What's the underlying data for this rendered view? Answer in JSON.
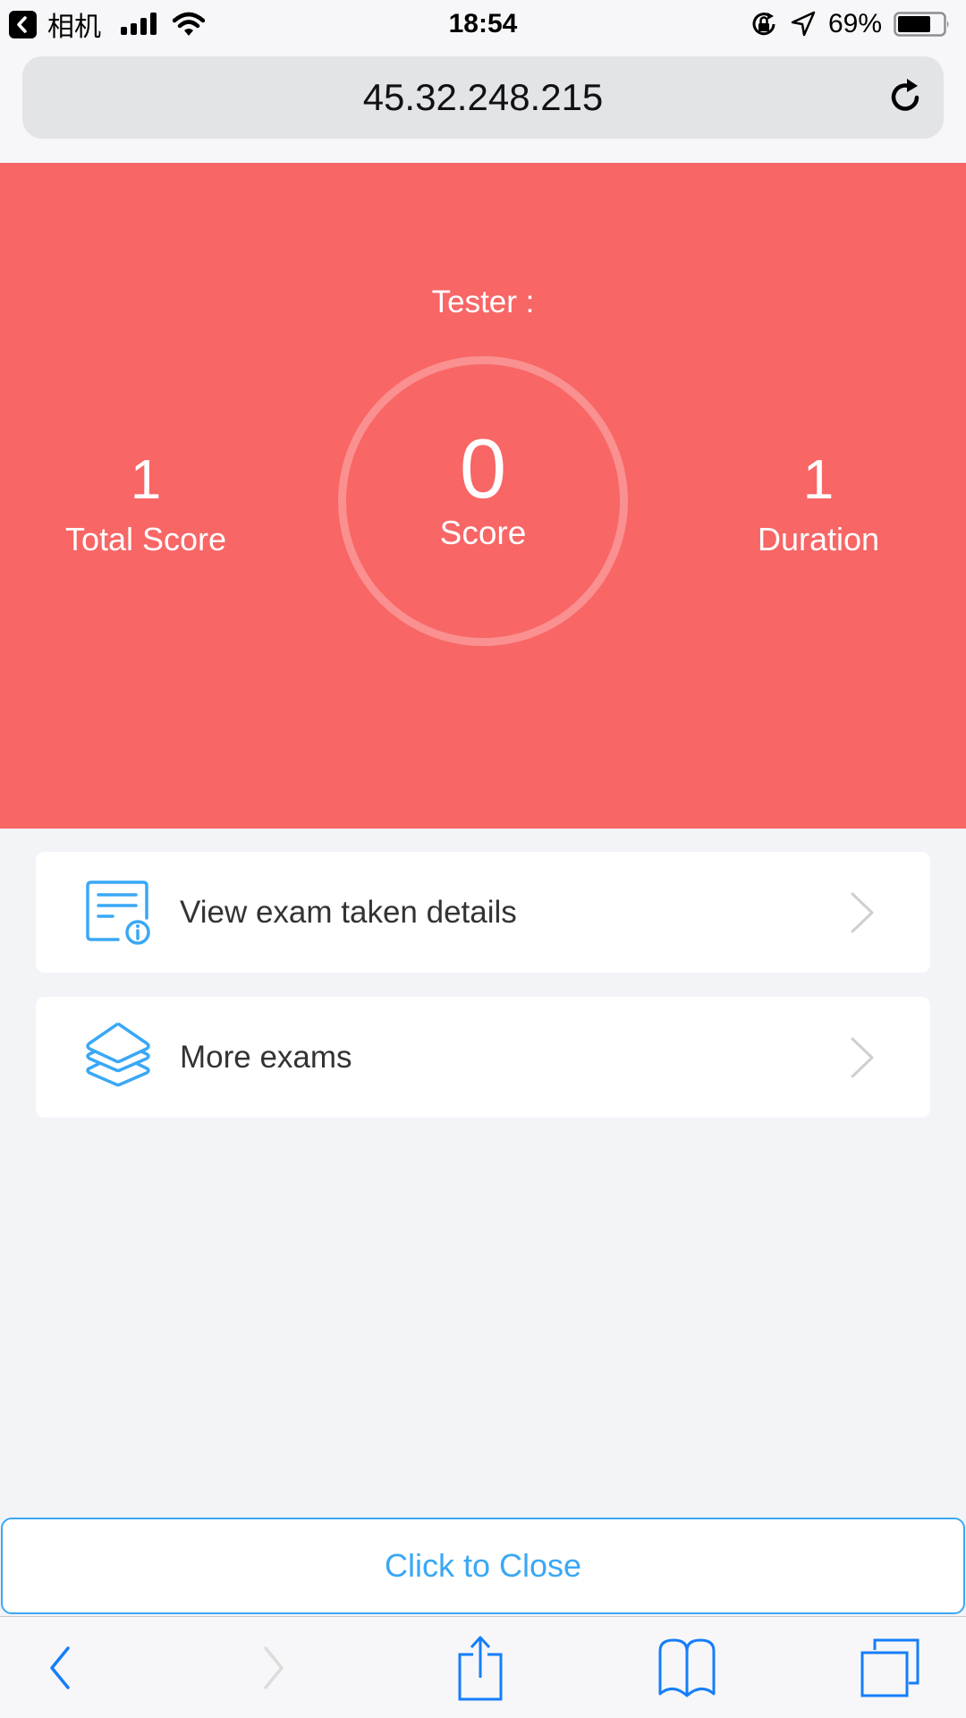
{
  "status_bar": {
    "back_app_label": "相机",
    "time": "18:54",
    "battery_percent": "69%",
    "battery_level": 0.69,
    "icons": [
      "back-to-app-icon",
      "signal-icon",
      "wifi-icon",
      "rotation-lock-icon",
      "location-icon",
      "battery-icon"
    ]
  },
  "address_bar": {
    "url": "45.32.248.215",
    "reload_icon": "reload-icon"
  },
  "result": {
    "tester_label": "Tester :",
    "total_score_value": "1",
    "total_score_label": "Total Score",
    "score_value": "0",
    "score_label": "Score",
    "duration_value": "1",
    "duration_label": "Duration",
    "background_color": "#f86666"
  },
  "menu": {
    "items": [
      {
        "label": "View exam taken details",
        "icon": "document-info-icon"
      },
      {
        "label": "More exams",
        "icon": "layers-icon"
      }
    ]
  },
  "close_button": {
    "label": "Click to Close",
    "color": "#3aa8f5"
  },
  "toolbar": {
    "items": [
      {
        "icon": "back-icon",
        "enabled": true
      },
      {
        "icon": "forward-icon",
        "enabled": false
      },
      {
        "icon": "share-icon",
        "enabled": true
      },
      {
        "icon": "bookmarks-icon",
        "enabled": true
      },
      {
        "icon": "tabs-icon",
        "enabled": true
      }
    ],
    "accent_color": "#157efb"
  }
}
